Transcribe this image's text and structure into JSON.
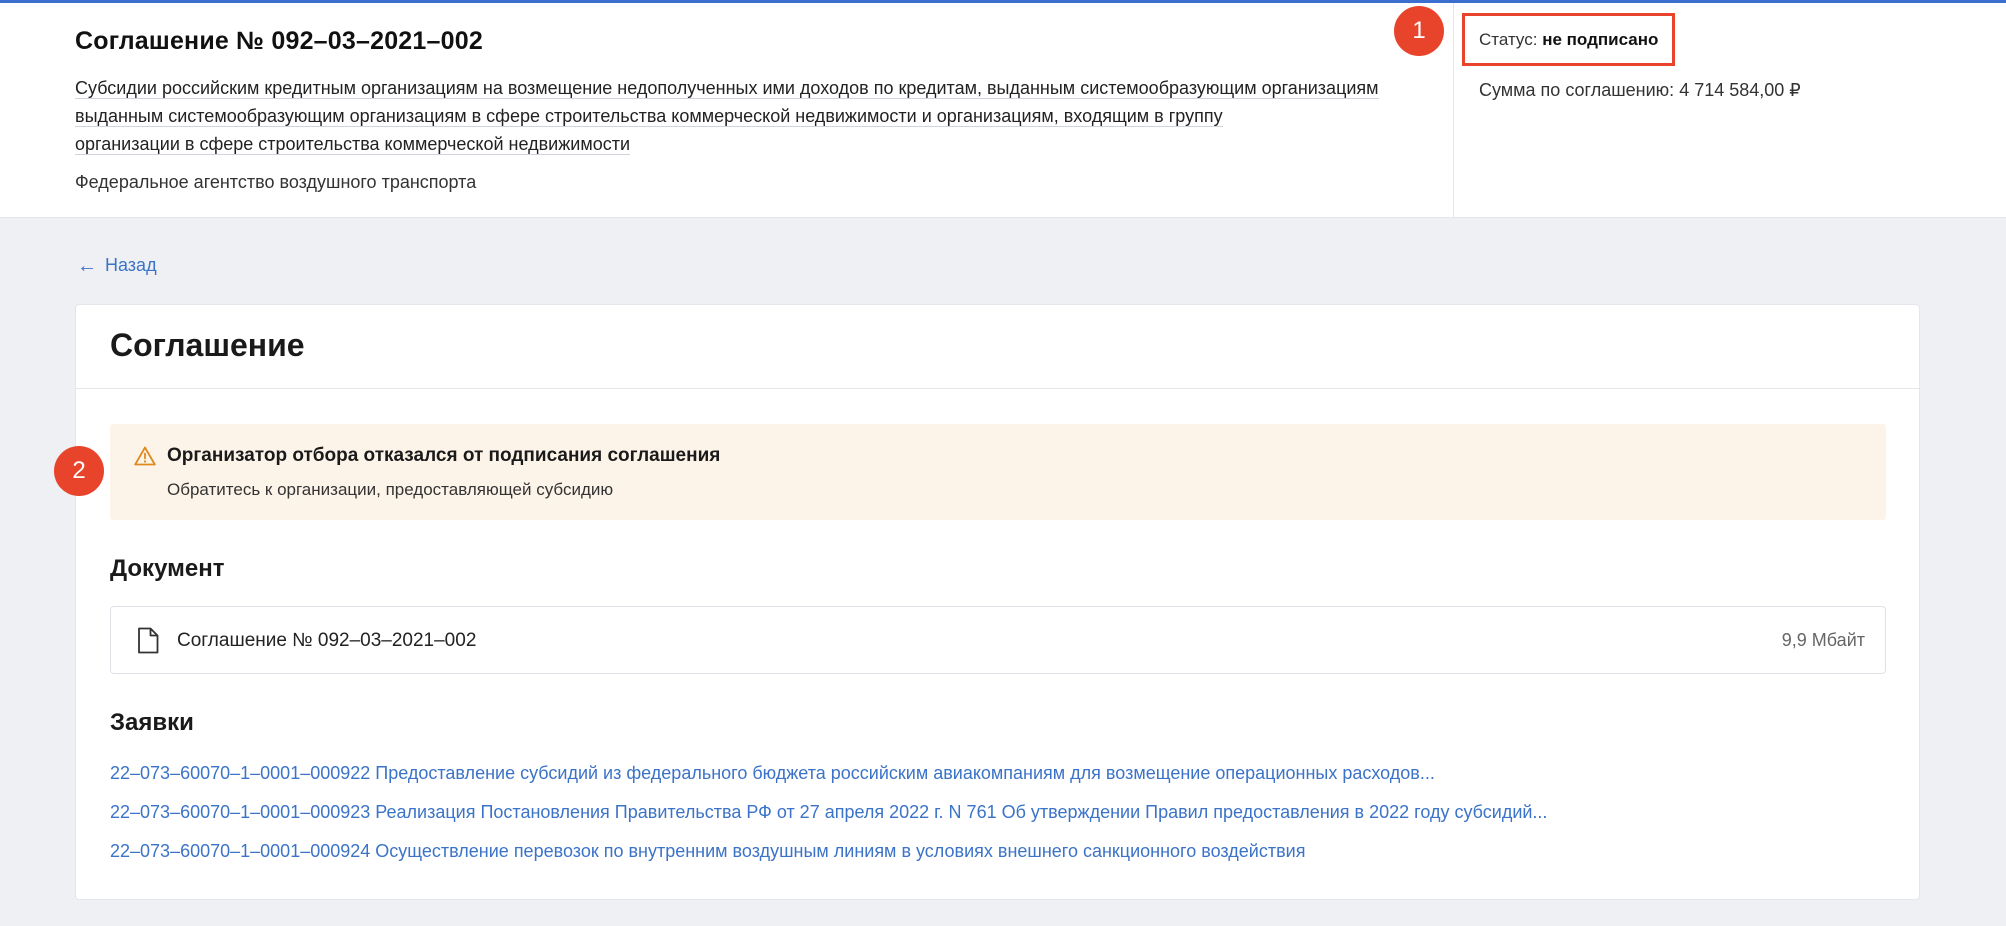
{
  "header": {
    "title": "Соглашение № 092–03–2021–002",
    "description_lines": [
      "Субсидии российским кредитным организациям на возмещение недополученных ими доходов по кредитам, выданным системообразующим организациям",
      "выданным системообразующим организациям в сфере строительства коммерческой недвижимости и организациям, входящим в группу",
      "организации в сфере строительства коммерческой недвижимости"
    ],
    "agency": "Федеральное агентство воздушного транспорта",
    "status_label": "Статус:",
    "status_value": "не подписано",
    "sum_label": "Сумма по соглашению:",
    "sum_value": "4 714 584,00 ₽"
  },
  "badges": [
    "1",
    "2"
  ],
  "back_link": {
    "label": "Назад",
    "icon": "arrow-left-icon"
  },
  "card": {
    "title": "Соглашение",
    "warning": {
      "icon": "warning-triangle-icon",
      "title": "Организатор отбора отказался от подписания соглашения",
      "text": "Обратитесь к организации, предоставляющей субсидию"
    },
    "document_section": {
      "title": "Документ",
      "file": {
        "icon": "file-icon",
        "name": "Соглашение № 092–03–2021–002",
        "size": "9,9 Мбайт"
      }
    },
    "applications_section": {
      "title": "Заявки",
      "items": [
        "22–073–60070–1–0001–000922 Предоставление субсидий из федерального бюджета российским авиакомпаниям для возмещение операционных расходов...",
        "22–073–60070–1–0001–000923 Реализация Постановления Правительства РФ от 27 апреля 2022 г. N 761 Об утверждении Правил предоставления в 2022 году субсидий...",
        "22–073–60070–1–0001–000924 Осуществление перевозок по внутренним воздушным линиям в условиях внешнего санкционного воздействия"
      ]
    }
  },
  "colors": {
    "accent": "#3b73c8",
    "annotation": "#e8442b",
    "warning_bg": "#fdf4e9",
    "warning_icon": "#e08a1e",
    "page_bg": "#eef0f4"
  }
}
